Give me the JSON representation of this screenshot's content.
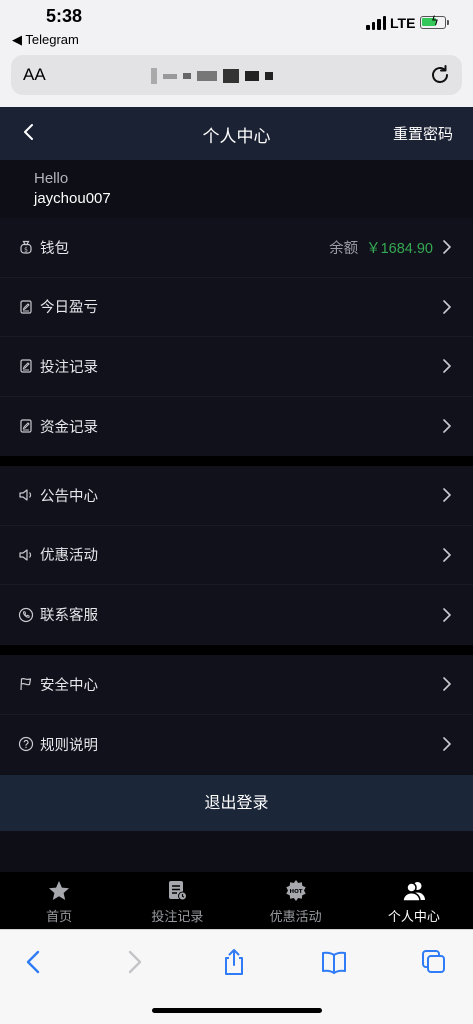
{
  "status": {
    "time": "5:38",
    "back_app": "◀ Telegram",
    "network": "LTE"
  },
  "browser": {
    "text_size_label": "AA"
  },
  "header": {
    "title": "个人中心",
    "right_action": "重置密码"
  },
  "profile": {
    "greeting": "Hello",
    "username": "jaychou007"
  },
  "wallet": {
    "label": "钱包",
    "balance_label": "余额",
    "balance_value": "￥1684.90"
  },
  "group1": [
    "今日盈亏",
    "投注记录",
    "资金记录"
  ],
  "group2": [
    "公告中心",
    "优惠活动",
    "联系客服"
  ],
  "group3": [
    "安全中心",
    "规则说明"
  ],
  "logout_label": "退出登录",
  "tabs": [
    {
      "label": "首页",
      "icon": "star-icon"
    },
    {
      "label": "投注记录",
      "icon": "bet-record-icon"
    },
    {
      "label": "优惠活动",
      "icon": "hot-badge-icon"
    },
    {
      "label": "个人中心",
      "icon": "user-icon"
    }
  ],
  "colors": {
    "header_bg": "#1b2233",
    "accent_green": "#35a853",
    "page_bg": "#0d0e16"
  }
}
